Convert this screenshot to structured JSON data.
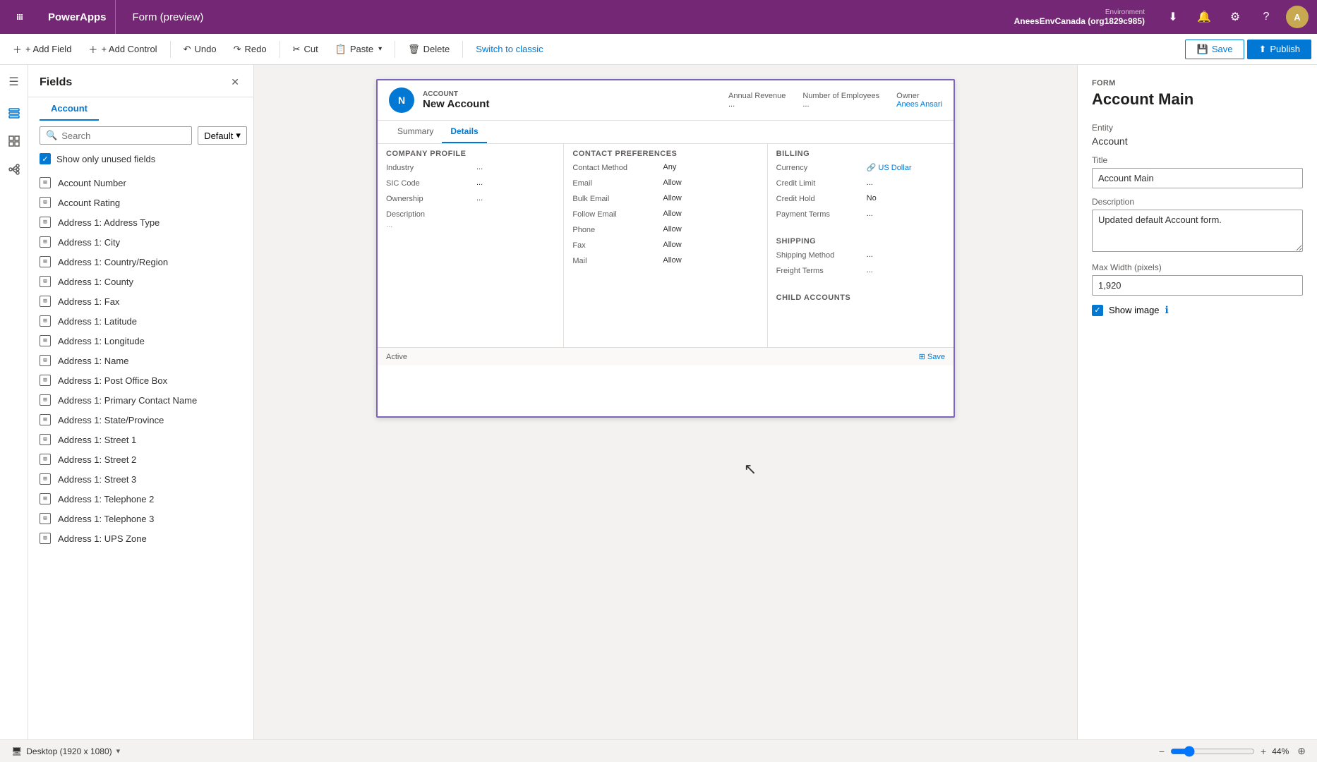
{
  "app": {
    "name": "PowerApps",
    "form_title": "Form (preview)"
  },
  "environment": {
    "label": "Environment",
    "name": "AneesEnvCanada (org1829c985)"
  },
  "toolbar": {
    "add_field": "+ Add Field",
    "add_control": "+ Add Control",
    "undo": "Undo",
    "redo": "Redo",
    "cut": "Cut",
    "paste": "Paste",
    "delete": "Delete",
    "switch_classic": "Switch to classic",
    "save": "Save",
    "publish": "Publish"
  },
  "fields_panel": {
    "title": "Fields",
    "entity": "Account",
    "search_placeholder": "Search",
    "filter_label": "Default",
    "show_unused_label": "Show only unused fields",
    "items": [
      "Account Number",
      "Account Rating",
      "Address 1: Address Type",
      "Address 1: City",
      "Address 1: Country/Region",
      "Address 1: County",
      "Address 1: Fax",
      "Address 1: Latitude",
      "Address 1: Longitude",
      "Address 1: Name",
      "Address 1: Post Office Box",
      "Address 1: Primary Contact Name",
      "Address 1: State/Province",
      "Address 1: Street 1",
      "Address 1: Street 2",
      "Address 1: Street 3",
      "Address 1: Telephone 2",
      "Address 1: Telephone 3",
      "Address 1: UPS Zone"
    ]
  },
  "form_preview": {
    "account_label": "ACCOUNT",
    "account_name": "New Account",
    "annual_revenue_label": "Annual Revenue",
    "annual_revenue_value": "...",
    "employees_label": "Number of Employees",
    "employees_value": "...",
    "owner_label": "Owner",
    "owner_value": "Anees Ansari",
    "tab_summary": "Summary",
    "tab_details": "Details",
    "sections": {
      "company_profile": {
        "header": "COMPANY PROFILE",
        "fields": [
          {
            "label": "Industry",
            "value": "..."
          },
          {
            "label": "SIC Code",
            "value": "..."
          },
          {
            "label": "Ownership",
            "value": "..."
          }
        ],
        "description_label": "Description",
        "description_value": "..."
      },
      "contact_preferences": {
        "header": "CONTACT PREFERENCES",
        "fields": [
          {
            "label": "Contact Method",
            "value": "Any"
          },
          {
            "label": "Email",
            "value": "Allow"
          },
          {
            "label": "Bulk Email",
            "value": "Allow"
          },
          {
            "label": "Follow Email",
            "value": "Allow"
          },
          {
            "label": "Phone",
            "value": "Allow"
          },
          {
            "label": "Fax",
            "value": "Allow"
          },
          {
            "label": "Mail",
            "value": "Allow"
          }
        ]
      },
      "billing": {
        "header": "BILLING",
        "fields": [
          {
            "label": "Currency",
            "value": "US Dollar",
            "link": true
          },
          {
            "label": "Credit Limit",
            "value": "..."
          },
          {
            "label": "Credit Hold",
            "value": "No"
          },
          {
            "label": "Payment Terms",
            "value": "..."
          }
        ]
      },
      "shipping": {
        "header": "SHIPPING",
        "fields": [
          {
            "label": "Shipping Method",
            "value": "..."
          },
          {
            "label": "Freight Terms",
            "value": "..."
          }
        ]
      },
      "child_accounts": {
        "header": "CHILD ACCOUNTS"
      }
    },
    "footer_status": "Active",
    "footer_save": "⊞ Save"
  },
  "right_panel": {
    "section_label": "Form",
    "title": "Account Main",
    "entity_label": "Entity",
    "entity_value": "Account",
    "title_label": "Title",
    "title_value": "Account Main",
    "description_label": "Description",
    "description_value": "Updated default Account form.",
    "max_width_label": "Max Width (pixels)",
    "max_width_value": "1,920",
    "show_image_label": "Show image"
  },
  "bottom_bar": {
    "device": "Desktop (1920 x 1080)",
    "zoom_minus": "−",
    "zoom_plus": "+",
    "zoom_level": "44%"
  }
}
